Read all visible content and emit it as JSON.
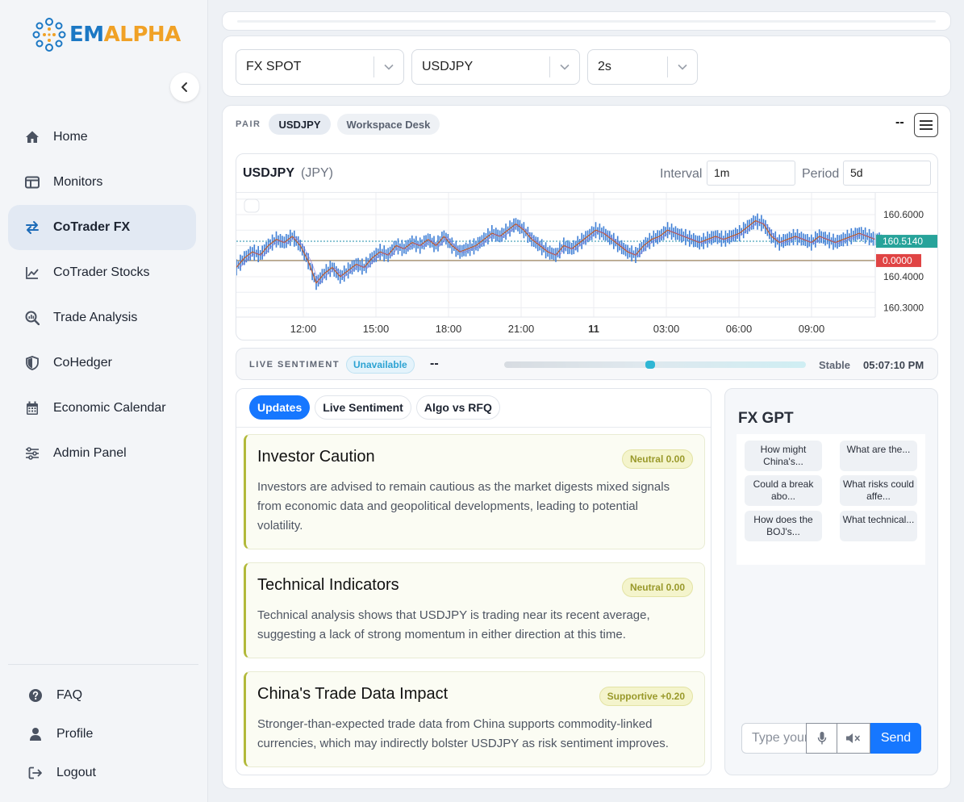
{
  "brand": {
    "name_part1": "EM",
    "name_part2": "ALPHA",
    "primary": "#1c78c4",
    "accent": "#f0a126"
  },
  "sidebar": {
    "items": [
      {
        "label": "Home",
        "icon": "home-icon"
      },
      {
        "label": "Monitors",
        "icon": "monitor-icon"
      },
      {
        "label": "CoTrader FX",
        "icon": "swap-icon",
        "active": true
      },
      {
        "label": "CoTrader Stocks",
        "icon": "line-chart-icon"
      },
      {
        "label": "Trade Analysis",
        "icon": "magnify-chart-icon"
      },
      {
        "label": "CoHedger",
        "icon": "shield-icon"
      },
      {
        "label": "Economic Calendar",
        "icon": "calendar-icon"
      },
      {
        "label": "Admin Panel",
        "icon": "sliders-icon"
      }
    ],
    "bottom": [
      {
        "label": "FAQ",
        "icon": "question-icon"
      },
      {
        "label": "Profile",
        "icon": "user-icon"
      },
      {
        "label": "Logout",
        "icon": "logout-icon"
      }
    ]
  },
  "selectors": {
    "market": "FX SPOT",
    "pair": "USDJPY",
    "interval": "2s"
  },
  "pair_bar": {
    "label": "PAIR",
    "pair": "USDJPY",
    "workspace": "Workspace Desk",
    "value": "--"
  },
  "chart": {
    "symbol": "USDJPY",
    "currency": "(JPY)",
    "interval_label": "Interval",
    "interval_value": "1m",
    "period_label": "Period",
    "period_value": "5d",
    "last_price_tag": "160.5140",
    "zero_tag": "0.0000"
  },
  "chart_data": {
    "type": "line",
    "x_ticks": [
      "12:00",
      "15:00",
      "18:00",
      "21:00",
      "11",
      "03:00",
      "06:00",
      "09:00"
    ],
    "y_ticks": [
      160.6,
      160.4,
      160.3
    ],
    "y_tick_labels": [
      "160.6000",
      "160.4000",
      "160.3000"
    ],
    "ylim": [
      160.27,
      160.67
    ],
    "last_price": 160.514,
    "reference_level": 160.452,
    "series": [
      {
        "values": [
          160.43,
          160.46,
          160.48,
          160.47,
          160.5,
          160.52,
          160.51,
          160.53,
          160.5,
          160.45,
          160.38,
          160.41,
          160.43,
          160.4,
          160.42,
          160.44,
          160.43,
          160.46,
          160.48,
          160.47,
          160.5,
          160.49,
          160.51,
          160.5,
          160.52,
          160.5,
          160.53,
          160.5,
          160.48,
          160.49,
          160.5,
          160.52,
          160.54,
          160.53,
          160.55,
          160.57,
          160.55,
          160.52,
          160.5,
          160.48,
          160.47,
          160.5,
          160.49,
          160.51,
          160.53,
          160.55,
          160.54,
          160.52,
          160.5,
          160.48,
          160.47,
          160.5,
          160.52,
          160.53,
          160.55,
          160.54,
          160.53,
          160.52,
          160.51,
          160.52,
          160.53,
          160.52,
          160.53,
          160.54,
          160.56,
          160.58,
          160.57,
          160.53,
          160.51,
          160.52,
          160.53,
          160.52,
          160.51,
          160.53,
          160.52,
          160.51,
          160.52,
          160.53,
          160.54,
          160.53,
          160.52
        ]
      }
    ]
  },
  "sentiment": {
    "label": "LIVE SENTIMENT",
    "status": "Unavailable",
    "value": "--",
    "level": 0.5,
    "trend": "Stable",
    "time": "05:07:10 PM"
  },
  "tabs": [
    "Updates",
    "Live Sentiment",
    "Algo vs RFQ"
  ],
  "updates": [
    {
      "title": "Investor Caution",
      "badge": "Neutral 0.00",
      "body": "Investors are advised to remain cautious as the market digests mixed signals from economic data and geopolitical developments, leading to potential volatility."
    },
    {
      "title": "Technical Indicators",
      "badge": "Neutral 0.00",
      "body": "Technical analysis shows that USDJPY is trading near its recent average, suggesting a lack of strong momentum in either direction at this time."
    },
    {
      "title": "China's Trade Data Impact",
      "badge": "Supportive +0.20",
      "body": "Stronger-than-expected trade data from China supports commodity-linked currencies, which may indirectly bolster USDJPY as risk sentiment improves."
    }
  ],
  "gpt": {
    "title": "FX GPT",
    "suggestions": [
      "How might China's...",
      "What are the...",
      "Could a break abo...",
      "What risks could affe...",
      "How does the BOJ's...",
      "What technical..."
    ],
    "input_placeholder": "Type your question",
    "send_label": "Send"
  }
}
